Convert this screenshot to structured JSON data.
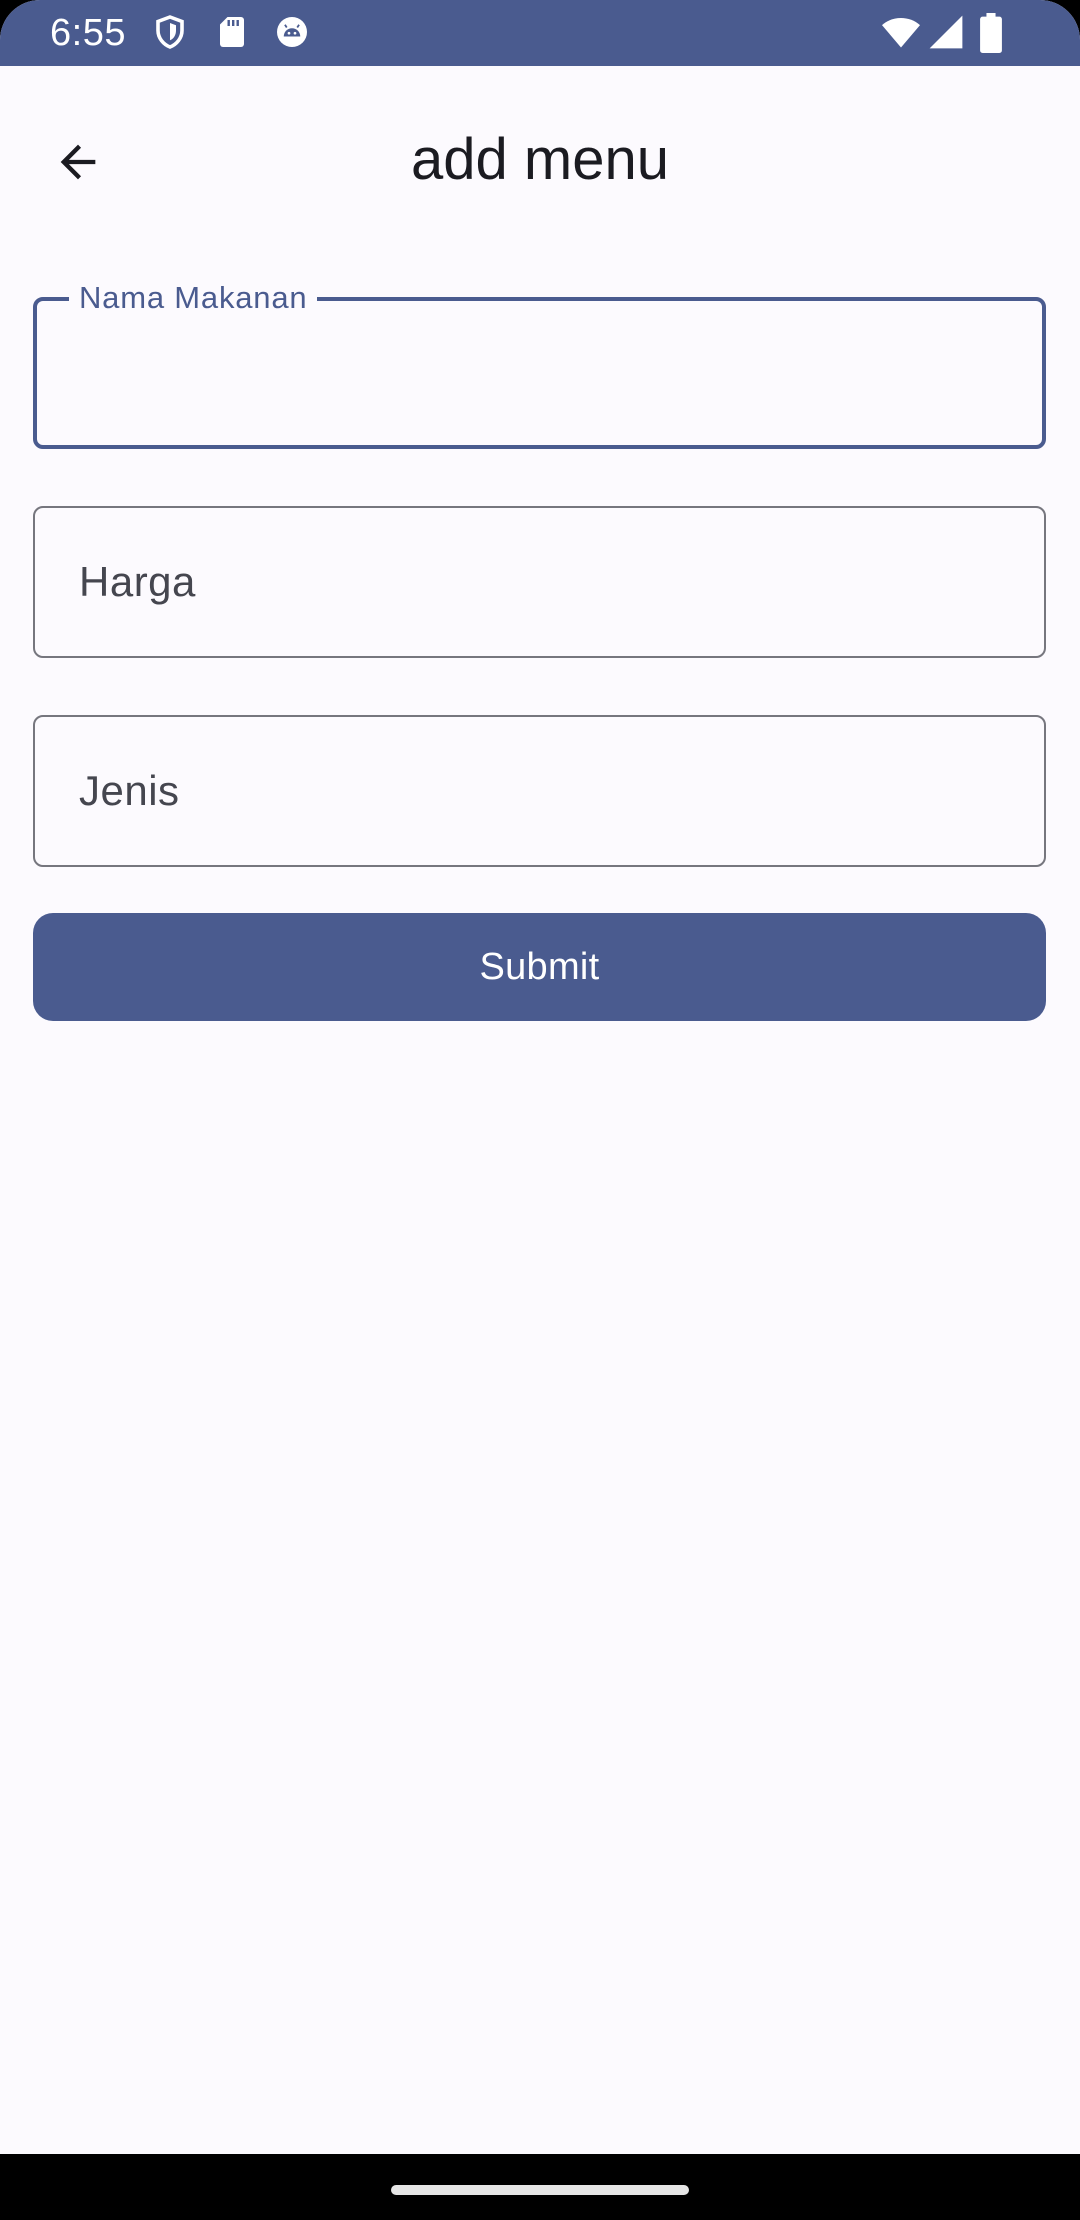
{
  "status_bar": {
    "time": "6:55",
    "left_icons": [
      "shield-icon",
      "sd-card-icon",
      "android-debug-icon"
    ],
    "right_icons": [
      "wifi-icon",
      "cellular-signal-icon",
      "battery-icon"
    ],
    "background_color": "#4A5B8F"
  },
  "app_bar": {
    "title": "add menu",
    "back_icon": "arrow-back-icon"
  },
  "form": {
    "fields": [
      {
        "label": "Nama Makanan",
        "value": "",
        "state": "focused"
      },
      {
        "label": "Harga",
        "value": "",
        "state": "idle"
      },
      {
        "label": "Jenis",
        "value": "",
        "state": "idle"
      }
    ],
    "submit_label": "Submit"
  },
  "colors": {
    "primary": "#4A5B8F",
    "background": "#FCFAFE",
    "outline": "#76767E"
  }
}
